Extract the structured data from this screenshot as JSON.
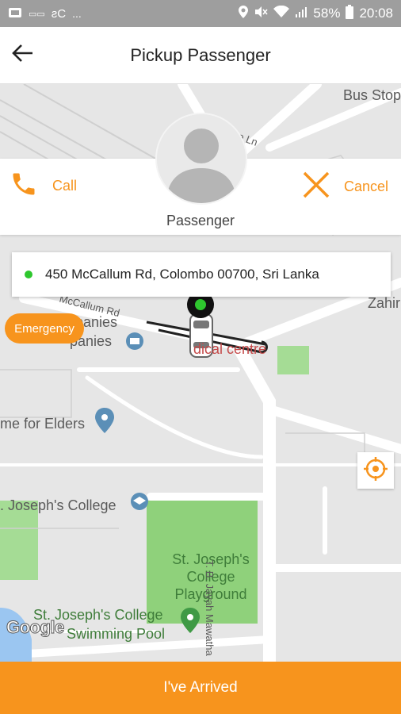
{
  "status_bar": {
    "left_text": "...",
    "battery": "58%",
    "time": "20:08"
  },
  "header": {
    "title": "Pickup Passenger"
  },
  "passenger": {
    "name": "Passenger",
    "call_label": "Call",
    "cancel_label": "Cancel"
  },
  "address": {
    "text": "450 McCallum Rd, Colombo 00700, Sri Lanka"
  },
  "emergency_label": "Emergency",
  "map": {
    "labels": {
      "bus_stop": "Bus Stop",
      "lane": "e Ln",
      "mccallum_rd": "McCallum Rd",
      "companies": "panies",
      "registrar": "rar of Companies",
      "zahira": "Zahir",
      "medical": "dical centre",
      "elders": "me for Elders",
      "st_josephs": ". Joseph's College",
      "playground_1": "St. Joseph's",
      "playground_2": "College",
      "playground_3": "Playground",
      "swimming_1": "St. Joseph's College",
      "swimming_2": "Swimming Pool",
      "tb_jayah": "T. B. Jayah Mawatha",
      "google": "Google"
    }
  },
  "action": {
    "arrived_label": "I've Arrived"
  },
  "colors": {
    "accent": "#f7941d",
    "status_bar": "#9e9e9e",
    "map_bg": "#e6e6e6",
    "park_green": "#8fd17b",
    "location_dot": "#2ec72e"
  }
}
